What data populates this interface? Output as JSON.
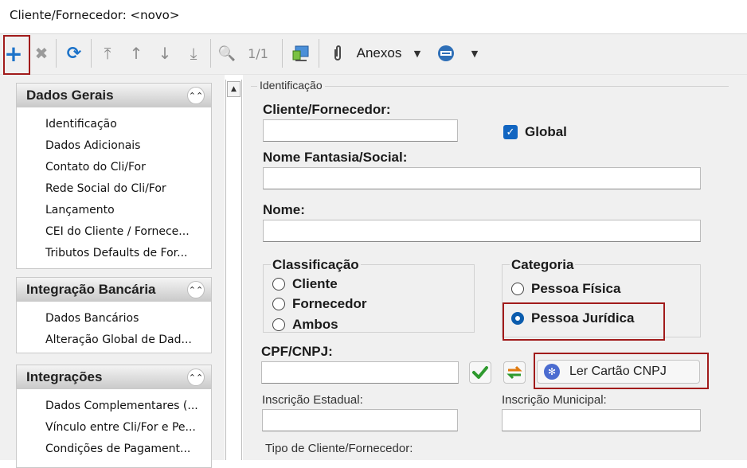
{
  "window": {
    "title": "Cliente/Fornecedor: <novo>"
  },
  "toolbar": {
    "add": "+",
    "delete": "✖",
    "refresh": "⟳",
    "first": "⤒",
    "prev": "↑",
    "next": "↓",
    "last": "⤓",
    "search": "🔍",
    "page": "1/1",
    "attachments_label": "Anexos",
    "caret": "▼"
  },
  "sidebar": {
    "panels": [
      {
        "title": "Dados Gerais",
        "items": [
          "Identificação",
          "Dados Adicionais",
          "Contato do Cli/For",
          "Rede Social do Cli/For",
          "Lançamento",
          "CEI do Cliente / Fornece...",
          "Tributos Defaults de For..."
        ]
      },
      {
        "title": "Integração Bancária",
        "items": [
          "Dados Bancários",
          "Alteração Global de Dad..."
        ]
      },
      {
        "title": "Integrações",
        "items": [
          "Dados Complementares (...",
          "Vínculo entre Cli/For e Pe...",
          "Condições de Pagament..."
        ]
      }
    ],
    "collapse_glyph": "⌃⌃"
  },
  "form": {
    "section_title": "Identificação",
    "cliente_fornecedor_label": "Cliente/Fornecedor:",
    "cliente_fornecedor_value": "",
    "global_label": "Global",
    "global_checked": true,
    "nome_fantasia_label": "Nome Fantasia/Social:",
    "nome_fantasia_value": "",
    "nome_label": "Nome:",
    "nome_value": "",
    "classificacao": {
      "title": "Classificação",
      "options": [
        "Cliente",
        "Fornecedor",
        "Ambos"
      ],
      "selected": null
    },
    "categoria": {
      "title": "Categoria",
      "options": [
        "Pessoa Física",
        "Pessoa Jurídica"
      ],
      "selected": "Pessoa Jurídica"
    },
    "cpf_cnpj_label": "CPF/CNPJ:",
    "cpf_cnpj_value": "",
    "ler_cartao_label": "Ler Cartão CNPJ",
    "inscricao_estadual_label": "Inscrição Estadual:",
    "inscricao_estadual_value": "",
    "inscricao_municipal_label": "Inscrição Municipal:",
    "inscricao_municipal_value": "",
    "tipo_label": "Tipo de Cliente/Fornecedor:"
  },
  "colors": {
    "accent": "#0b5cad",
    "highlight": "#a11b1b",
    "check_green": "#2f9a2f"
  }
}
